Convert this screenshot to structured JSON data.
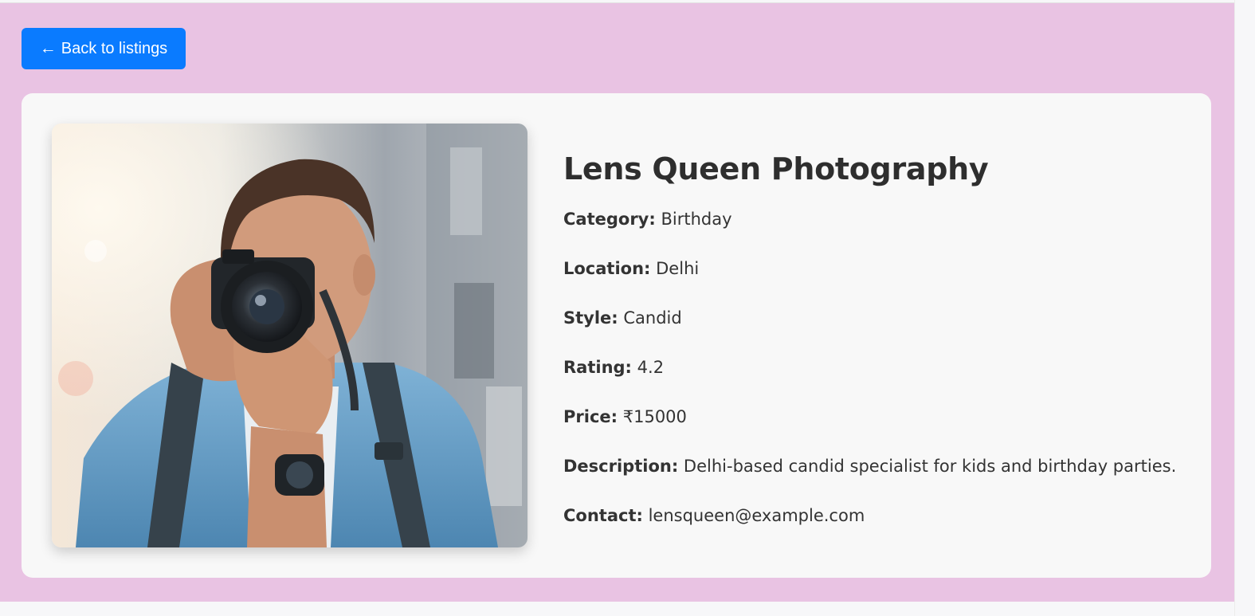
{
  "back_button": {
    "arrow": "←",
    "label": "Back to listings"
  },
  "listing": {
    "title": "Lens Queen Photography",
    "image_description": "photographer-holding-camera",
    "fields": [
      {
        "label": "Category:",
        "value": "Birthday"
      },
      {
        "label": "Location:",
        "value": "Delhi"
      },
      {
        "label": "Style:",
        "value": "Candid"
      },
      {
        "label": "Rating:",
        "value": "4.2"
      },
      {
        "label": "Price:",
        "value": "₹15000"
      },
      {
        "label": "Description:",
        "value": "Delhi-based candid specialist for kids and birthday parties."
      },
      {
        "label": "Contact:",
        "value": "lensqueen@example.com"
      }
    ]
  },
  "colors": {
    "page_background": "#e9c3e3",
    "card_background": "#f8f8f8",
    "button_background": "#0a7bff",
    "text": "#333333"
  }
}
